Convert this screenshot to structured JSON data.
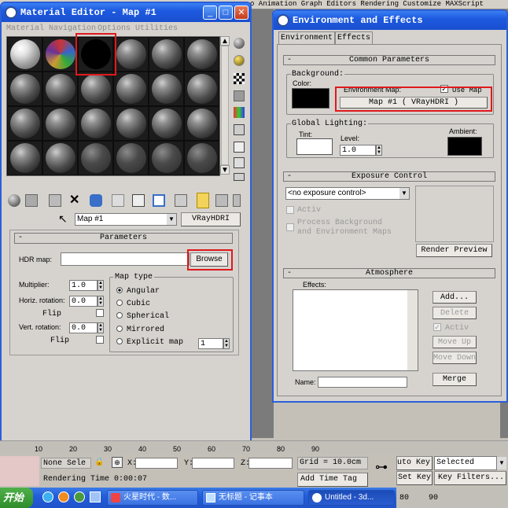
{
  "background_app": {
    "menu_text": "o Animation  Graph Editors  Rendering  Customize  MAXScript"
  },
  "material_editor": {
    "title": "Material Editor - Map #1",
    "menus": [
      "Material",
      "Navigation",
      "Options",
      "Utilities"
    ],
    "map_name": "Map #1",
    "map_type_button": "VRayHDRI",
    "params_header": "Parameters",
    "hdr_map_label": "HDR map:",
    "hdr_map_value": "",
    "browse_label": "Browse",
    "multiplier_label": "Multiplier:",
    "multiplier_value": "1.0",
    "horiz_rotation_label": "Horiz. rotation:",
    "horiz_rotation_value": "0.0",
    "flip1_label": "Flip",
    "vert_rotation_label": "Vert. rotation:",
    "vert_rotation_value": "0.0",
    "flip2_label": "Flip",
    "map_type_label": "Map type",
    "map_types": [
      "Angular",
      "Cubic",
      "Spherical",
      "Mirrored",
      "Explicit map"
    ],
    "selected_map_type": "Angular",
    "explicit_map_value": "1"
  },
  "env_effects": {
    "title": "Environment and Effects",
    "tabs": [
      "Environment",
      "Effects"
    ],
    "common_params_header": "Common Parameters",
    "background_label": "Background:",
    "color_label": "Color:",
    "env_map_label": "Environment Map:",
    "use_map_label": "Use Map",
    "use_map_checked": true,
    "env_map_button": "Map #1  ( VRayHDRI )",
    "global_lighting_label": "Global Lighting:",
    "tint_label": "Tint:",
    "level_label": "Level:",
    "level_value": "1.0",
    "ambient_label": "Ambient:",
    "exposure_header": "Exposure Control",
    "exposure_select": "<no exposure control>",
    "active_label": "Activ",
    "process_bg_label": "Process Background",
    "process_bg_label2": "and Environment Maps",
    "render_preview": "Render Preview",
    "atmosphere_header": "Atmosphere",
    "effects_label": "Effects:",
    "add_label": "Add...",
    "delete_label": "Delete",
    "active2_label": "Activ",
    "move_up_label": "Move Up",
    "move_down_label": "Move Down",
    "name_label": "Name:",
    "merge_label": "Merge"
  },
  "status_bar": {
    "ticks": [
      "10",
      "20",
      "30",
      "40",
      "50",
      "60",
      "70",
      "80",
      "90"
    ],
    "none_selected": "None Sele",
    "x_label": "X:",
    "y_label": "Y:",
    "z_label": "Z:",
    "grid": "Grid = 10.0cm",
    "auto_key": "uto Key",
    "selected": "Selected",
    "rendering_time": "Rendering Time  0:00:07",
    "add_time_tag": "Add Time Tag",
    "set_key": "Set Key",
    "key_filters": "Key Filters...",
    "right_ticks": [
      "80",
      "90"
    ]
  },
  "taskbar": {
    "start": "开始",
    "tasks": [
      "火星时代 - 数...",
      "无标题 - 记事本",
      "Untitled - 3d..."
    ]
  }
}
